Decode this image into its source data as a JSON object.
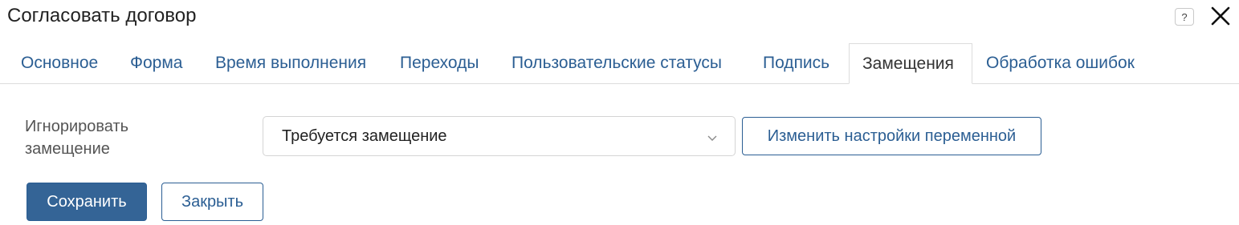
{
  "dialog": {
    "title": "Согласовать договор",
    "help_label": "?",
    "help_icon": "question-icon",
    "close_icon": "close-icon"
  },
  "tabs": [
    {
      "label": "Основное",
      "active": false
    },
    {
      "label": "Форма",
      "active": false
    },
    {
      "label": "Время выполнения",
      "active": false
    },
    {
      "label": "Переходы",
      "active": false
    },
    {
      "label": "Пользовательские статусы",
      "active": false
    },
    {
      "label": "Подпись",
      "active": false
    },
    {
      "label": "Замещения",
      "active": true
    },
    {
      "label": "Обработка ошибок",
      "active": false
    }
  ],
  "form": {
    "ignore_label": "Игнорировать замещение",
    "ignore_value": "Требуется замещение",
    "change_var_button": "Изменить настройки переменной"
  },
  "footer": {
    "save_button": "Сохранить",
    "close_button": "Закрыть"
  },
  "colors": {
    "accent": "#2b5e93",
    "primary_button": "#346496",
    "border": "#dcdcdc"
  }
}
